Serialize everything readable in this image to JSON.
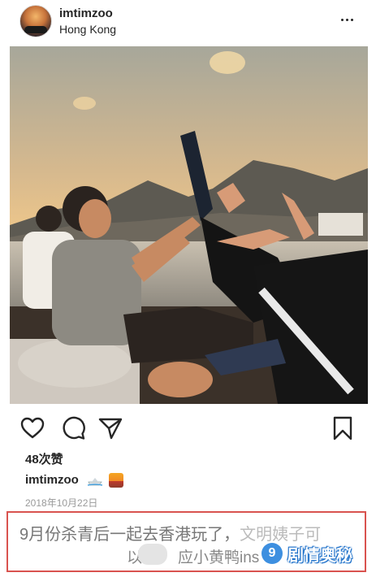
{
  "post": {
    "username": "imtimzoo",
    "location": "Hong Kong",
    "likes": "48次赞",
    "caption_user": "imtimzoo",
    "caption_emojis": [
      "speedboat-emoji",
      "sunset-emoji"
    ],
    "date": "2018年10月22日"
  },
  "overlay": {
    "line1": "9月份杀青后一起去香港玩了，",
    "line1_faded": "文明姨子可",
    "line2_prefix": "以",
    "line2_suffix": "应小黄鸭ins",
    "watermark_logo": "9",
    "watermark_text": "剧情奥秘"
  },
  "icons": {
    "more": "more-options-icon",
    "like": "heart-icon",
    "comment": "comment-icon",
    "share": "share-icon",
    "save": "bookmark-icon"
  },
  "colors": {
    "text": "#262626",
    "date": "#999999",
    "overlay_border": "#d9534f",
    "watermark_blue": "#3d8fe0"
  }
}
